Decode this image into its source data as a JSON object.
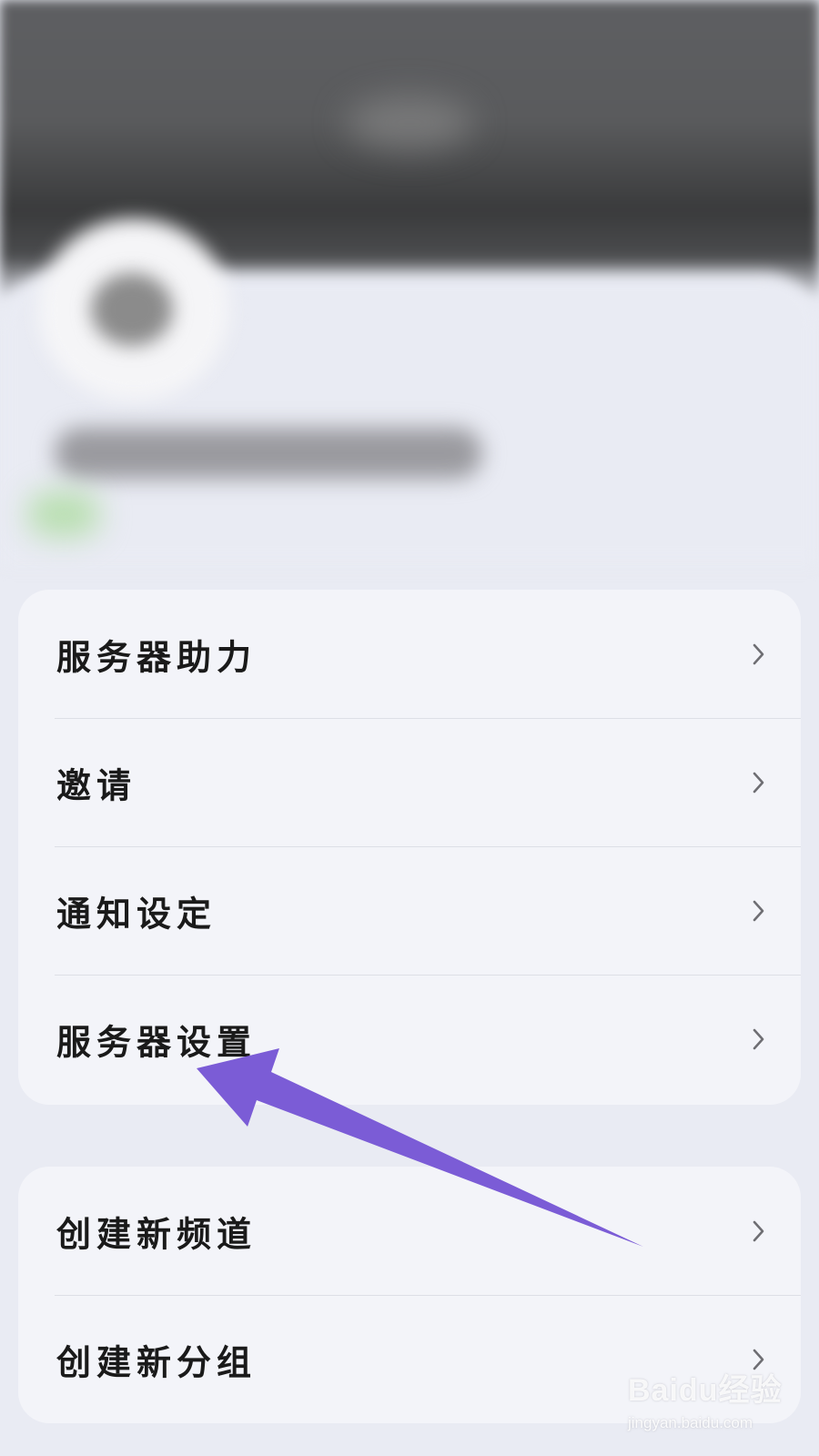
{
  "menu_group_1": [
    {
      "label": "服务器助力"
    },
    {
      "label": "邀请"
    },
    {
      "label": "通知设定"
    },
    {
      "label": "服务器设置"
    }
  ],
  "menu_group_2": [
    {
      "label": "创建新频道"
    },
    {
      "label": "创建新分组"
    }
  ],
  "chevron_icon": "chevron-right-icon",
  "annotation_color": "#7b5cd6",
  "watermark": {
    "main": "Baidu经验",
    "sub": "jingyan.baidu.com"
  }
}
